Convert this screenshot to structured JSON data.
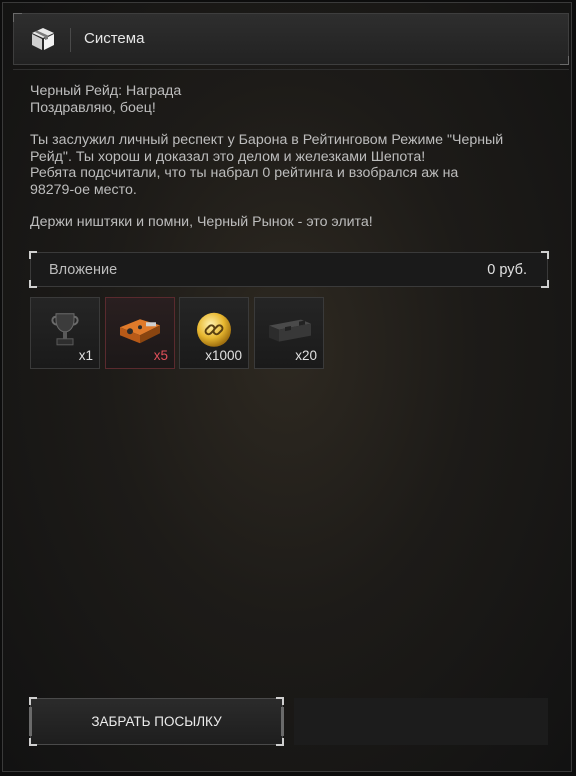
{
  "window": {
    "title": "Система"
  },
  "message": {
    "subject": "Черный Рейд: Награда",
    "greeting": "Поздравляю, боец!",
    "p1_line1": "Ты заслужил личный респект у Барона в Рейтинговом Режиме \"Черный",
    "p1_line2": "Рейд\". Ты хорош и доказал это делом и железками Шепота!",
    "p1_line3": "Ребята подсчитали, что ты набрал 0 рейтинга и взобрался аж на",
    "p1_line4": "98279-ое место.",
    "p2": "Держи ништяки и помни, Черный Рынок - это элита!"
  },
  "attachment": {
    "label": "Вложение",
    "amount": "0 руб."
  },
  "items": [
    {
      "icon": "trophy-icon",
      "qty": "x1"
    },
    {
      "icon": "orange-case-icon",
      "qty": "x5"
    },
    {
      "icon": "gold-chain-coin-icon",
      "qty": "x1000"
    },
    {
      "icon": "ammo-crate-icon",
      "qty": "x20"
    }
  ],
  "buttons": {
    "claim": "ЗАБРАТЬ ПОСЫЛКУ"
  },
  "colors": {
    "accent_red": "#e0505a",
    "text": "#bdbdbd",
    "panel": "#1a1a1a"
  }
}
